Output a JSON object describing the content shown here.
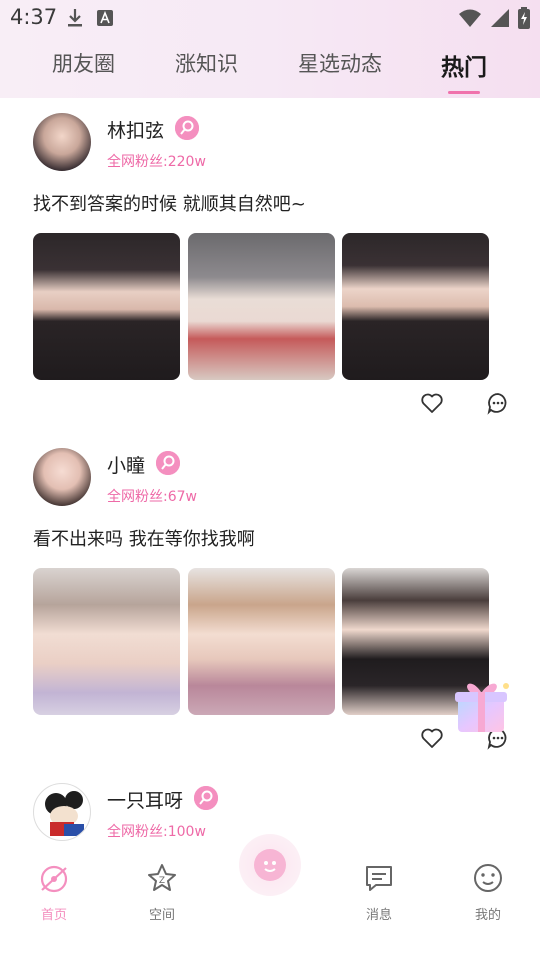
{
  "status_bar": {
    "time": "4:37"
  },
  "tabs": [
    {
      "label": "朋友圈",
      "active": false
    },
    {
      "label": "涨知识",
      "active": false
    },
    {
      "label": "星选动态",
      "active": false
    },
    {
      "label": "热门",
      "active": true
    }
  ],
  "posts": [
    {
      "name": "林扣弦",
      "fans": "全网粉丝:220w",
      "caption": "找不到答案的时候 就顺其自然吧~"
    },
    {
      "name": "小瞳",
      "fans": "全网粉丝:67w",
      "caption": "看不出来吗 我在等你找我啊"
    },
    {
      "name": "一只耳呀",
      "fans": "全网粉丝:100w",
      "caption": ""
    }
  ],
  "bottom_nav": [
    {
      "label": "首页",
      "icon": "home-icon",
      "active": true
    },
    {
      "label": "空间",
      "icon": "star-icon",
      "active": false
    },
    {
      "label": "",
      "icon": "center-face-icon",
      "active": false
    },
    {
      "label": "消息",
      "icon": "message-icon",
      "active": false
    },
    {
      "label": "我的",
      "icon": "profile-icon",
      "active": false
    }
  ],
  "colors": {
    "accent": "#f48fbf",
    "fans_text": "#ee6aa7",
    "header_bg": "#f6e9f5"
  }
}
